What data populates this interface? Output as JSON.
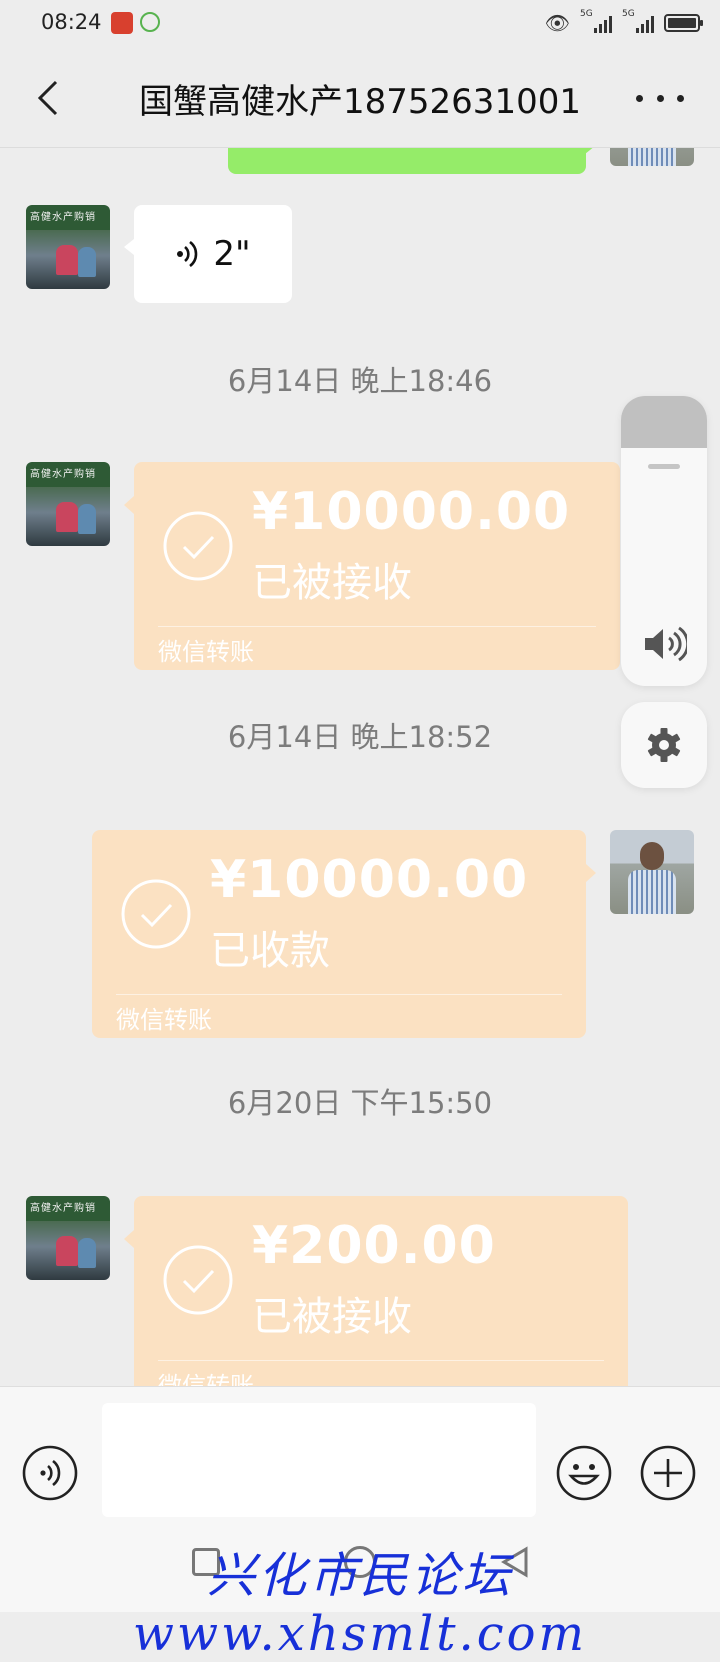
{
  "status_bar": {
    "time": "08:24",
    "network_1": "5G",
    "network_2": "5G"
  },
  "header": {
    "title": "国蟹高健水产18752631001"
  },
  "messages": [
    {
      "type": "text",
      "side": "right"
    },
    {
      "type": "voice",
      "side": "left",
      "duration": "2\""
    },
    {
      "type": "timestamp",
      "text": "6月14日 晚上18:46"
    },
    {
      "type": "transfer",
      "side": "left",
      "amount": "¥10000.00",
      "status": "已被接收",
      "label": "微信转账"
    },
    {
      "type": "timestamp",
      "text": "6月14日 晚上18:52"
    },
    {
      "type": "transfer",
      "side": "right",
      "amount": "¥10000.00",
      "status": "已收款",
      "label": "微信转账"
    },
    {
      "type": "timestamp",
      "text": "6月20日 下午15:50"
    },
    {
      "type": "transfer",
      "side": "left",
      "amount": "¥200.00",
      "status": "已被接收",
      "label": "微信转账"
    }
  ],
  "shop_avatar_sign": "高健水产购销",
  "volume_panel": {
    "level_fraction": 0.18
  },
  "input": {
    "value": ""
  },
  "watermark": "兴化市民论坛 www.xhsmlt.com",
  "colors": {
    "background": "#ededed",
    "transfer_bubble": "#fbe1c2",
    "sent_bubble": "#95ec69",
    "watermark": "#1730d8"
  }
}
